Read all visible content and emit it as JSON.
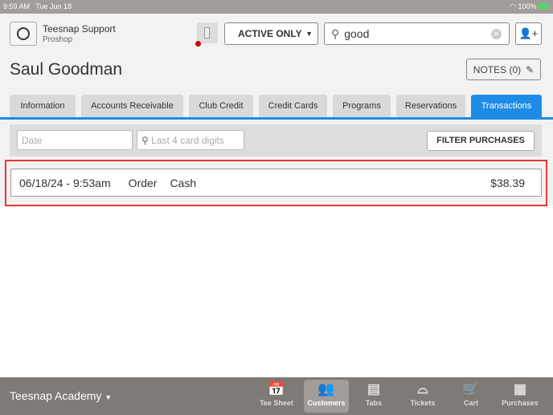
{
  "status_bar": {
    "time": "9:59 AM",
    "date": "Tue Jun 18",
    "battery": "100%"
  },
  "header": {
    "user_name": "Teesnap Support",
    "user_role": "Proshop",
    "filter_select": "ACTIVE ONLY",
    "search_value": "good"
  },
  "customer": {
    "name": "Saul Goodman",
    "notes_label": "NOTES (0)"
  },
  "tabs": [
    {
      "label": "Information",
      "active": false
    },
    {
      "label": "Accounts Receivable",
      "active": false
    },
    {
      "label": "Club Credit",
      "active": false
    },
    {
      "label": "Credit Cards",
      "active": false
    },
    {
      "label": "Programs",
      "active": false
    },
    {
      "label": "Reservations",
      "active": false
    },
    {
      "label": "Transactions",
      "active": true
    }
  ],
  "filters": {
    "date_placeholder": "Date",
    "card_placeholder": "Last 4 card digits",
    "filter_button": "FILTER PURCHASES"
  },
  "transactions": [
    {
      "datetime": "06/18/24 - 9:53am",
      "type": "Order",
      "method": "Cash",
      "amount": "$38.39"
    }
  ],
  "bottom_bar": {
    "location": "Teesnap Academy",
    "nav": [
      {
        "label": "Tee Sheet",
        "icon": "calendar-icon",
        "active": false
      },
      {
        "label": "Customers",
        "icon": "customers-icon",
        "active": true
      },
      {
        "label": "Tabs",
        "icon": "tabs-icon",
        "active": false
      },
      {
        "label": "Tickets",
        "icon": "bell-icon",
        "active": false
      },
      {
        "label": "Cart",
        "icon": "cart-icon",
        "active": false
      },
      {
        "label": "Purchases",
        "icon": "register-icon",
        "active": false
      }
    ]
  },
  "colors": {
    "accent": "#1e8ce6",
    "highlight": "#e53a2e",
    "bottom_bar": "#7f7a76"
  }
}
